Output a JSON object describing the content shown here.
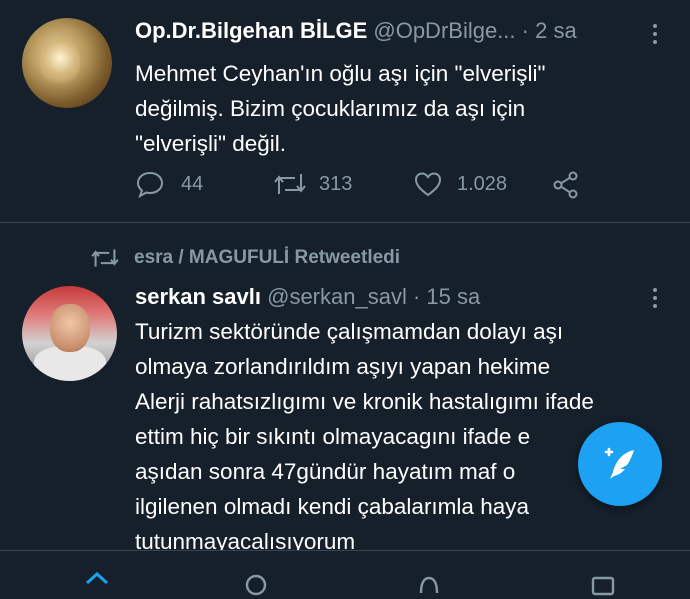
{
  "tweet1": {
    "author_name": "Op.Dr.Bilgehan BİLGE",
    "handle": "@OpDrBilge...",
    "time": "· 2 sa",
    "lines": [
      "Mehmet Ceyhan'ın oğlu aşı için \"elverişli\"",
      "değilmiş. Bizim çocuklarımız da aşı için",
      "\"elverişli\" değil."
    ],
    "replies": "44",
    "retweets": "313",
    "likes": "1.028"
  },
  "retweet_context": {
    "label": "esra / MAGUFULİ Retweetledi"
  },
  "tweet2": {
    "author_name": "serkan savlı",
    "handle": "@serkan_savl",
    "time": "· 15 sa",
    "lines": [
      "Turizm sektöründe çalışmamdan dolayı aşı",
      "olmaya zorlandırıldım aşıyı yapan hekime",
      "Alerji rahatsızlıgımı ve kronik hastalıgımı ifade",
      "ettim hiç bir sıkıntı olmayacagını ifade e",
      "aşıdan sonra 47gündür hayatım maf o",
      "ilgilenen olmadı kendi çabalarımla haya",
      "tutunmayacalısıyorum"
    ]
  },
  "colors": {
    "background": "#15202b",
    "muted": "#8899a6",
    "accent": "#1da1f2",
    "divider": "#38444d"
  },
  "icons": {
    "reply": "reply-icon",
    "retweet": "retweet-icon",
    "like": "heart-icon",
    "share": "share-icon",
    "more": "more-vertical-icon",
    "compose": "compose-tweet-icon"
  }
}
